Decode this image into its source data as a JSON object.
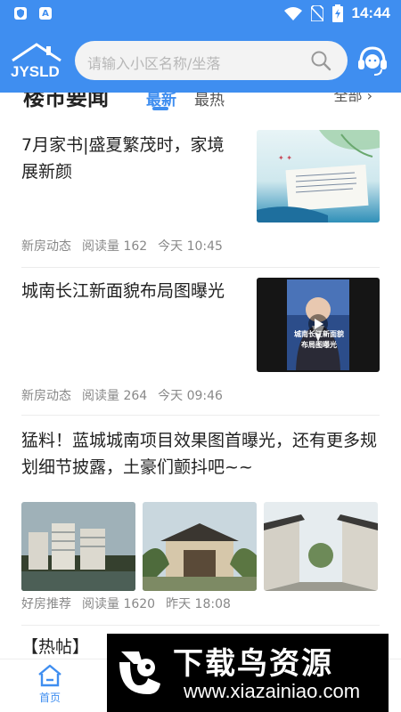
{
  "statusbar": {
    "time": "14:44",
    "notif_label": "A"
  },
  "header": {
    "search_placeholder": "请输入小区名称/坐落"
  },
  "section": {
    "title": "楼市要闻",
    "tabs": [
      "最新",
      "最热"
    ],
    "all_label": "全部"
  },
  "articles": [
    {
      "title": "7月家书|盛夏繁茂时，家境展新颜",
      "category": "新房动态",
      "reads": "阅读量 162",
      "time": "今天 10:45"
    },
    {
      "title": "城南长江新面貌布局图曝光",
      "category": "新房动态",
      "reads": "阅读量 264",
      "time": "今天 09:46",
      "video_caption_1": "城南长江新面貌",
      "video_caption_2": "布局图曝光"
    },
    {
      "title": "猛料！蓝城城南项目效果图首曝光，还有更多规划细节披露，土豪们颤抖吧~~",
      "category": "好房推荐",
      "reads": "阅读量 1620",
      "time": "昨天 18:08"
    }
  ],
  "partial_next_article": "【热帖】",
  "bottom_nav": {
    "home_label": "首页"
  },
  "watermark": {
    "title": "下载鸟资源",
    "url": "www.xiazainiao.com"
  },
  "colors": {
    "brand_blue": "#3f8ef0"
  }
}
